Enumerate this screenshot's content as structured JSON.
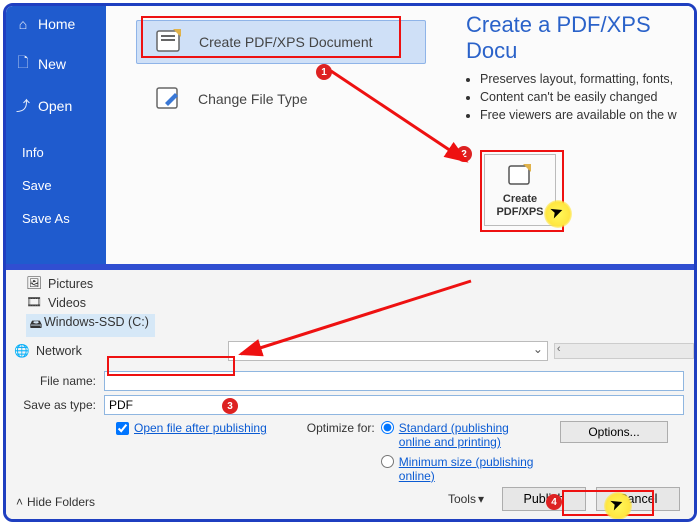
{
  "sidebar": {
    "home": "Home",
    "new": "New",
    "open": "Open",
    "info": "Info",
    "save": "Save",
    "saveas": "Save As"
  },
  "export": {
    "opt1": "Create PDF/XPS Document",
    "opt2": "Change File Type"
  },
  "info": {
    "title": "Create a PDF/XPS Docu",
    "b1": "Preserves layout, formatting, fonts,",
    "b2": "Content can't be easily changed",
    "b3": "Free viewers are available on the w",
    "btn": "Create PDF/XPS"
  },
  "dialog": {
    "tree": {
      "pictures": "Pictures",
      "videos": "Videos",
      "ssd": "Windows-SSD (C:)",
      "network": "Network"
    },
    "filename_label": "File name:",
    "filename_value": "",
    "type_label": "Save as type:",
    "type_value": "PDF",
    "open_after": "Open file after publishing",
    "optimize_label": "Optimize for:",
    "opt_standard": "Standard (publishing online and printing)",
    "opt_min": "Minimum size (publishing online)",
    "options_btn": "Options...",
    "tools": "Tools",
    "publish": "Publish",
    "cancel": "Cancel",
    "hide": "Hide Folders"
  }
}
